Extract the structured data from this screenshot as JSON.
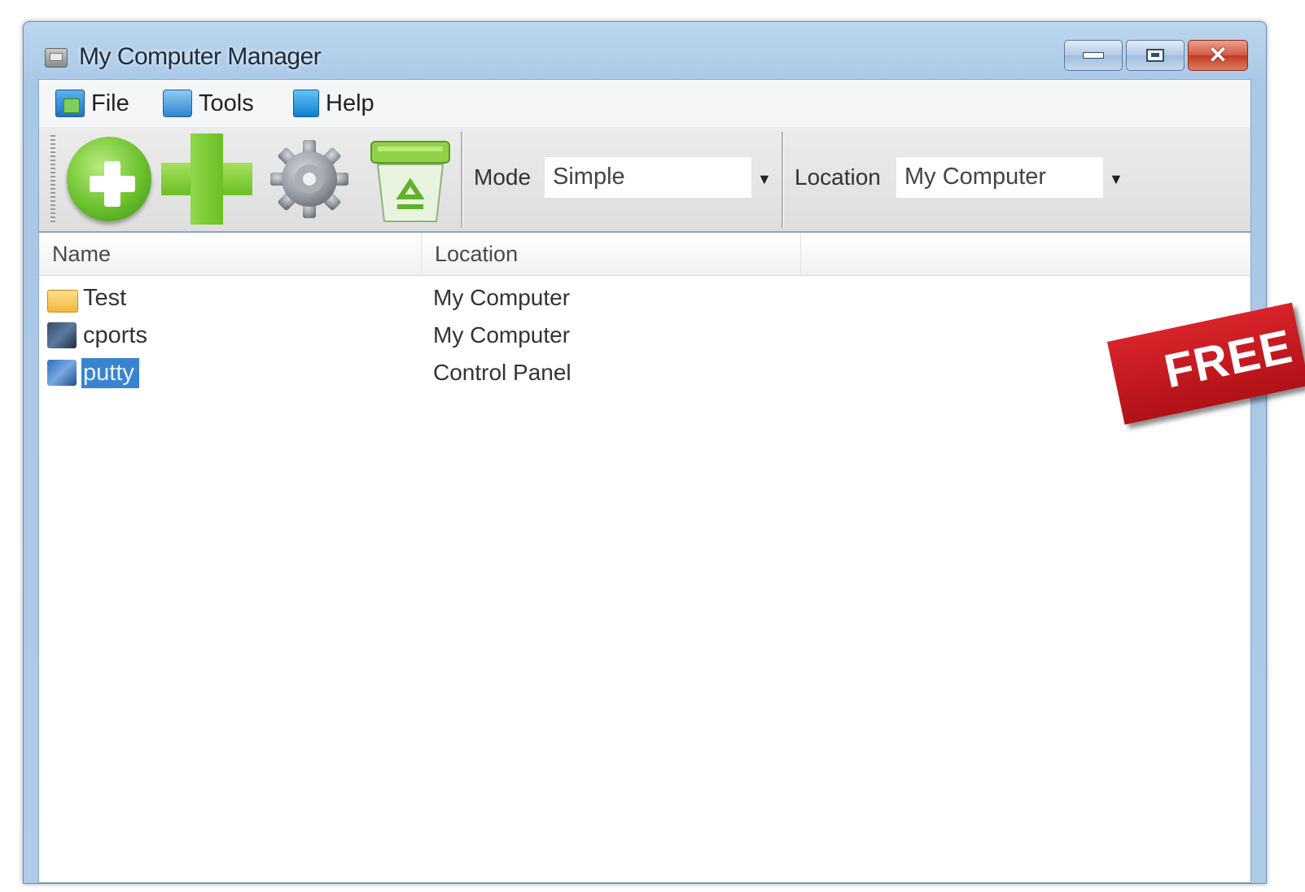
{
  "window": {
    "title": "My Computer Manager"
  },
  "menu": {
    "file": "File",
    "tools": "Tools",
    "help": "Help"
  },
  "toolbar": {
    "mode_label": "Mode",
    "mode_value": "Simple",
    "location_label": "Location",
    "location_value": "My Computer"
  },
  "list": {
    "columns": [
      "Name",
      "Location"
    ],
    "rows": [
      {
        "name": "Test",
        "location": "My Computer",
        "icon": "folder-icon",
        "selected": false
      },
      {
        "name": "cports",
        "location": "My Computer",
        "icon": "cports-icon",
        "selected": false
      },
      {
        "name": "putty",
        "location": "Control Panel",
        "icon": "putty-icon",
        "selected": true
      }
    ]
  },
  "badge": {
    "text": "FREE"
  },
  "colors": {
    "selection": "#3a83cf",
    "accent_green": "#6cc12d",
    "badge_red": "#c4151b"
  }
}
